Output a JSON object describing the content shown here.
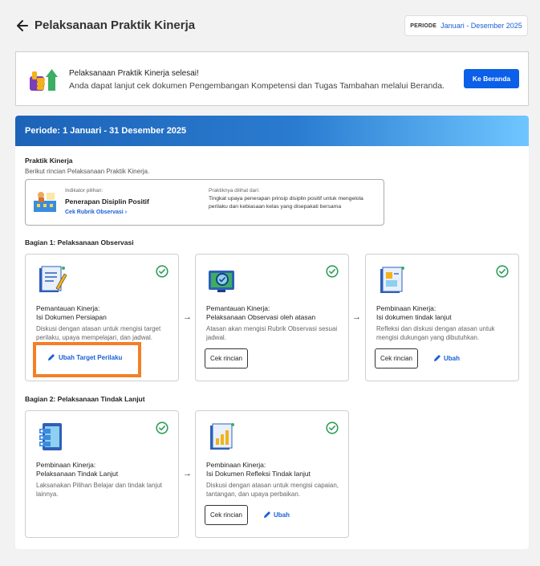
{
  "header": {
    "title": "Pelaksanaan Praktik Kinerja",
    "periode_label": "PERIODE",
    "periode_value": "Januari - Desember 2025"
  },
  "notice": {
    "title": "Pelaksanaan Praktik Kinerja selesai!",
    "subtitle": "Anda dapat lanjut cek dokumen Pengembangan Kompetensi dan Tugas Tambahan melalui Beranda.",
    "button": "Ke Beranda",
    "icon": "thumbs-up-growth-icon"
  },
  "main": {
    "period_text": "Periode: 1 Januari - 31 Desember 2025",
    "praktik": {
      "title": "Praktik Kinerja",
      "subtitle": "Berikut rincian Pelaksanaan Praktik Kinerja.",
      "indicator_label": "Indikator pilihan:",
      "indicator_value": "Penerapan Disiplin Positif",
      "indicator_link": "Cek Rubrik Observasi",
      "praktik_label": "Praktiknya dilihat dari:",
      "praktik_value": "Tingkat upaya penerapan prinsip disiplin positif untuk mengelola perilaku dan kebiasaan kelas yang disepakati bersama"
    },
    "bagian1": {
      "title": "Bagian 1: Pelaksanaan Observasi",
      "cards": [
        {
          "t1": "Pemantauan Kinerja:",
          "t2": "Isi Dokumen Persiapan",
          "desc": "Diskusi dengan atasan untuk mengisi target perilaku, upaya mempelajari, dan jadwal.",
          "link": "Ubah Target Perilaku"
        },
        {
          "t1": "Pemantauan Kinerja:",
          "t2": "Pelaksanaan Observasi oleh atasan",
          "desc": "Atasan akan mengisi Rubrik Observasi sesuai jadwal.",
          "button": "Cek rincian"
        },
        {
          "t1": "Pembinaan Kinerja:",
          "t2": "Isi dokumen tindak lanjut",
          "desc": "Refleksi dan diskusi dengan atasan untuk mengisi dukungan yang dibutuhkan.",
          "button": "Cek rincian",
          "link": "Ubah"
        }
      ]
    },
    "bagian2": {
      "title": "Bagian 2: Pelaksanaan Tindak Lanjut",
      "cards": [
        {
          "t1": "Pembinaan Kinerja:",
          "t2": "Pelaksanaan Tindak Lanjut",
          "desc": "Laksanakan Pilihan Belajar dan tindak lanjut lainnya."
        },
        {
          "t1": "Pembinaan Kinerja:",
          "t2": "Isi Dokumen Refleksi Tindak lanjut",
          "desc": "Diskusi dengan atasan untuk mengisi capaian, tantangan, dan upaya perbaikan.",
          "button": "Cek rincian",
          "link": "Ubah"
        }
      ]
    }
  },
  "colors": {
    "accent": "#0b5fe8",
    "link": "#1a5fd6",
    "check": "#2e9e5b",
    "highlight": "#f37f28"
  }
}
